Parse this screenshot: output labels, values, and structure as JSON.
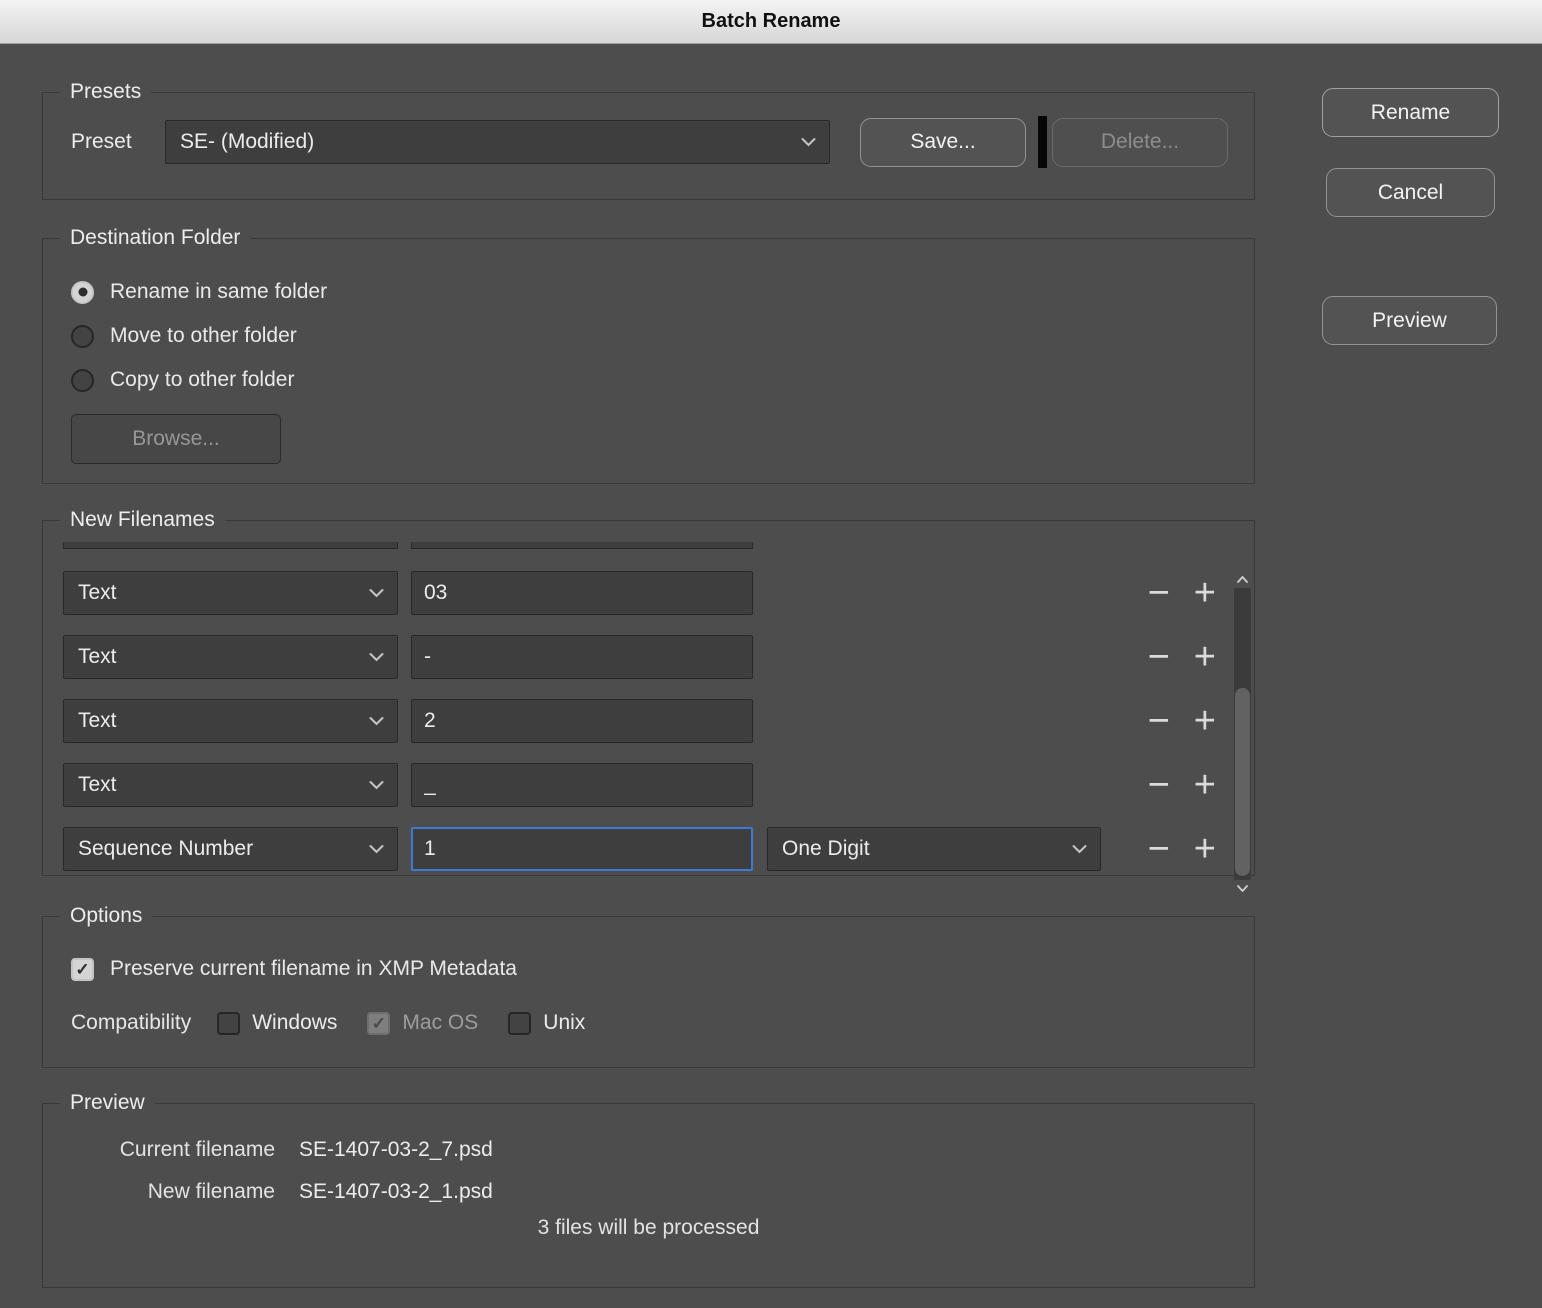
{
  "window": {
    "title": "Batch Rename"
  },
  "actions": {
    "rename": "Rename",
    "cancel": "Cancel",
    "preview": "Preview"
  },
  "presets": {
    "legend": "Presets",
    "label": "Preset",
    "value": "SE- (Modified)",
    "save": "Save...",
    "delete": "Delete..."
  },
  "destination": {
    "legend": "Destination Folder",
    "options": [
      {
        "label": "Rename in same folder",
        "selected": true
      },
      {
        "label": "Move to other folder",
        "selected": false
      },
      {
        "label": "Copy to other folder",
        "selected": false
      }
    ],
    "browse": "Browse..."
  },
  "filenames": {
    "legend": "New Filenames",
    "rows": [
      {
        "type": "Text",
        "value": "03"
      },
      {
        "type": "Text",
        "value": "-"
      },
      {
        "type": "Text",
        "value": "2"
      },
      {
        "type": "Text",
        "value": "_"
      },
      {
        "type": "Sequence Number",
        "value": "1",
        "digits": "One Digit",
        "focused": true
      }
    ],
    "minus": "−",
    "plus": "+"
  },
  "options": {
    "legend": "Options",
    "preserve": "Preserve current filename in XMP Metadata",
    "preserve_checked": true,
    "compatibility": "Compatibility",
    "compat": [
      {
        "label": "Windows",
        "checked": false,
        "disabled": false
      },
      {
        "label": "Mac OS",
        "checked": true,
        "disabled": true
      },
      {
        "label": "Unix",
        "checked": false,
        "disabled": false
      }
    ],
    "check_glyph": "✓"
  },
  "preview": {
    "legend": "Preview",
    "current_label": "Current filename",
    "current_value": "SE-1407-03-2_7.psd",
    "new_label": "New filename",
    "new_value": "SE-1407-03-2_1.psd",
    "note": "3 files will be processed"
  },
  "colors": {
    "background": "#4d4d4d",
    "focus_border": "#3e7bd0",
    "accent_light": "#d4d4d4"
  }
}
